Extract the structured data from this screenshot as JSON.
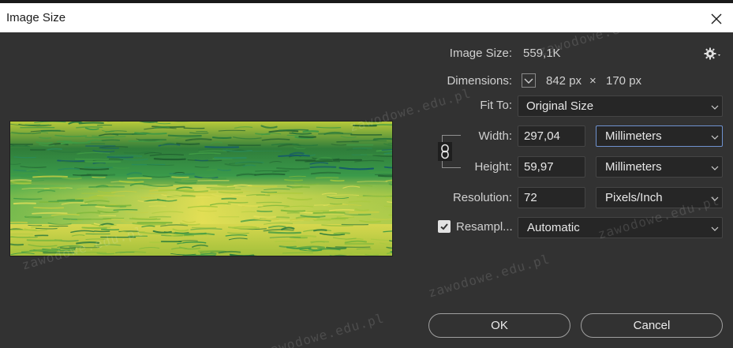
{
  "window": {
    "title": "Image Size"
  },
  "info": {
    "image_size_label": "Image Size:",
    "image_size_value": "559,1K",
    "dimensions_label": "Dimensions:",
    "dimensions_width": "842 px",
    "dimensions_times": "×",
    "dimensions_height": "170 px"
  },
  "fit_to": {
    "label": "Fit To:",
    "value": "Original Size"
  },
  "width": {
    "label": "Width:",
    "value": "297,04",
    "unit": "Millimeters"
  },
  "height": {
    "label": "Height:",
    "value": "59,97",
    "unit": "Millimeters"
  },
  "resolution": {
    "label": "Resolution:",
    "value": "72",
    "unit": "Pixels/Inch"
  },
  "resample": {
    "label": "Resampl...",
    "checked": true,
    "value": "Automatic"
  },
  "buttons": {
    "ok": "OK",
    "cancel": "Cancel"
  },
  "watermark": "zawodowe.edu.pl",
  "icons": {
    "close": "close-icon",
    "gear": "gear-icon",
    "link": "link-icon",
    "chevron": "chevron-down-icon"
  },
  "colors": {
    "background": "#323232",
    "field": "#262626",
    "focus_border": "#6f92cf",
    "titlebar": "#ffffff"
  }
}
